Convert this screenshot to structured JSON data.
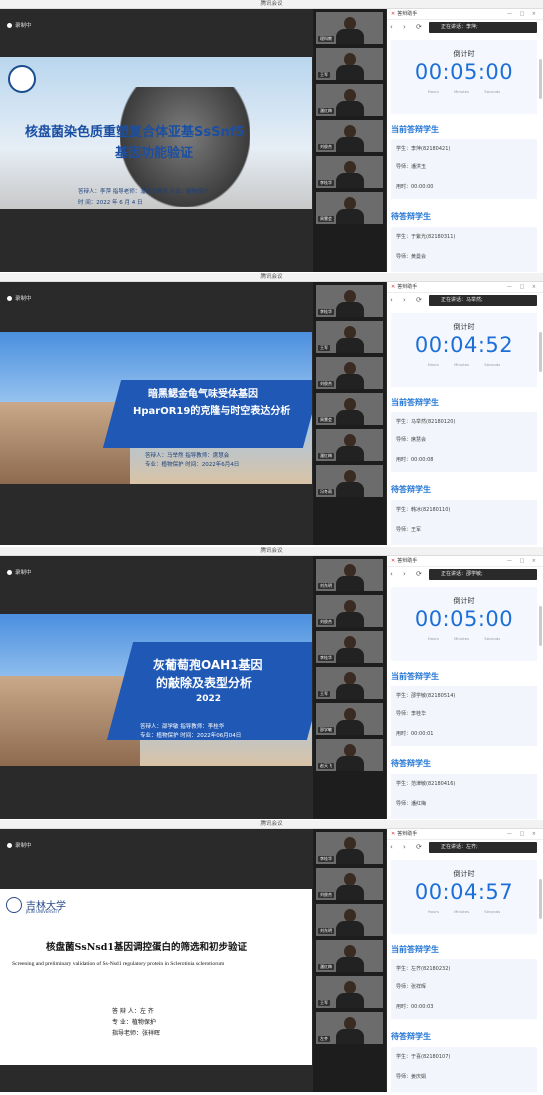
{
  "window_title": "腾讯会议",
  "recording": "录制中",
  "panel": {
    "app_name": "答辩助手",
    "countdown_title": "倒计时",
    "units": [
      "Hours",
      "Minutes",
      "Seconds"
    ],
    "current_section": "当前答辩学生",
    "waiting_section": "待答辩学生",
    "nav_glyphs": "‹ › ⟳",
    "win_ctrl": "— □ ×"
  },
  "shots": [
    {
      "slide_title_line1": "核盘菌染色质重塑复合体亚基SsSnf5",
      "slide_title_line2": "基因功能验证",
      "slide_info": "答辩人：李萍   指导老师：潘洪玉教授   专业：植物保护",
      "slide_date": "时   间：2022 年 6 月 4 日",
      "speaking": "正在讲话：李萍;",
      "timer": "00:05:00",
      "current": {
        "student": "学生：李萍(82180421)",
        "advisor": "导师：潘洪玉",
        "elapsed": "用时：00:00:00"
      },
      "waiting": {
        "student": "学生：于紫光(82180311)",
        "advisor": "导师：黄曼会"
      },
      "cams": [
        "理科教",
        "王军",
        "潘红梅",
        "刘俊杰",
        "李桂华",
        "周慧会"
      ]
    },
    {
      "slide_title_line1": "暗黑鳃金龟气味受体基因",
      "slide_title_line2": "HparOR19的克隆与时空表达分析",
      "slide_info": "答辩人：马举然    指导教师：席慧会",
      "slide_date": "专业：植物保护    时间：2022年6月4日",
      "speaking": "正在讲话：马举然;",
      "timer": "00:04:52",
      "current": {
        "student": "学生：马举然(82180120)",
        "advisor": "导师：席慧会",
        "elapsed": "用时：00:00:08"
      },
      "waiting": {
        "student": "学生：韩冰(82180110)",
        "advisor": "导师：王军"
      },
      "cams": [
        "李桂华",
        "王军",
        "刘俊杰",
        "周慧会",
        "潘红梅",
        "冯冬雨"
      ]
    },
    {
      "slide_title_line1": "灰葡萄孢OAH1基因",
      "slide_title_line2": "的敲除及表型分析",
      "slide_year": "2022",
      "slide_info": "答辩人：邵学敏    指导教师：李桂华",
      "slide_date": "专业：植物保护    时间：2022年06月04日",
      "speaking": "正在讲话：邵学敏;",
      "timer": "00:05:00",
      "current": {
        "student": "学生：邵学敏(82180514)",
        "advisor": "导师：李桂华",
        "elapsed": "用时：00:00:01"
      },
      "waiting": {
        "student": "学生：范津敏(82180416)",
        "advisor": "导师：潘红梅"
      },
      "cams": [
        "刘东明",
        "刘俊杰",
        "李桂华",
        "王军",
        "邵学敏",
        "赵天飞"
      ]
    },
    {
      "slide_title_line1": "核盘菌SsNsd1基因调控蛋白的筛选和初步验证",
      "slide_title_line2": "Screening and preliminary validation of Ss-Nsd1 regulatory protein in Sclerotinia sclerotiorum",
      "slide_info": "答 辩 人：左 齐",
      "slide_info2": "专    业：植物保护",
      "slide_date": "指导老师：张祥晖",
      "slide_logo": "吉林大学",
      "slide_logo_en": "JILIN UNIVERSITY",
      "speaking": "正在讲话：左齐;",
      "timer": "00:04:57",
      "current": {
        "student": "学生：左齐(82180232)",
        "advisor": "导师：张祥晖",
        "elapsed": "用时：00:00:03"
      },
      "waiting": {
        "student": "学生：于喜(82180107)",
        "advisor": "导师：姜庆娟"
      },
      "cams": [
        "李桂华",
        "刘俊杰",
        "刘东明",
        "潘红梅",
        "王军",
        "左齐"
      ]
    }
  ],
  "colors": {
    "accent": "#1d6fd8",
    "section": "#2376d5"
  }
}
